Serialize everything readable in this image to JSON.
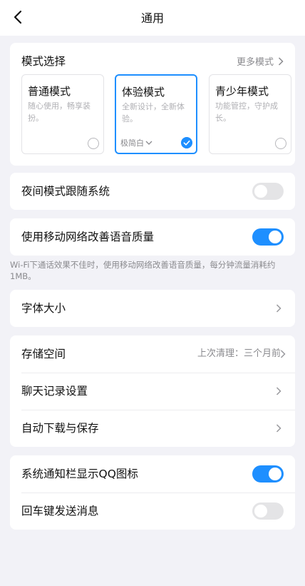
{
  "nav": {
    "title": "通用"
  },
  "mode": {
    "header": "模式选择",
    "more": "更多模式",
    "options": [
      {
        "name": "普通模式",
        "desc": "随心使用，畅享装扮。",
        "selected": false
      },
      {
        "name": "体验模式",
        "desc": "全新设计，全新体验。",
        "selected": true,
        "theme": "极简白"
      },
      {
        "name": "青少年模式",
        "desc": "功能管控，守护成长。",
        "selected": false
      }
    ]
  },
  "night_mode": {
    "label": "夜间模式跟随系统",
    "on": false
  },
  "mobile_network": {
    "label": "使用移动网络改善语音质量",
    "on": true,
    "note": "Wi-Fi下通话效果不佳时，使用移动网络改善语音质量，每分钟流量消耗约1MB。"
  },
  "font_size": {
    "label": "字体大小"
  },
  "storage": {
    "label": "存储空间",
    "last_clean": "上次清理：三个月前"
  },
  "chat_history": {
    "label": "聊天记录设置"
  },
  "auto_download": {
    "label": "自动下载与保存"
  },
  "notification_icon": {
    "label": "系统通知栏显示QQ图标",
    "on": true
  },
  "enter_send": {
    "label": "回车键发送消息",
    "on": false
  },
  "colors": {
    "accent": "#1e8fff",
    "background": "#f2f2f7"
  }
}
